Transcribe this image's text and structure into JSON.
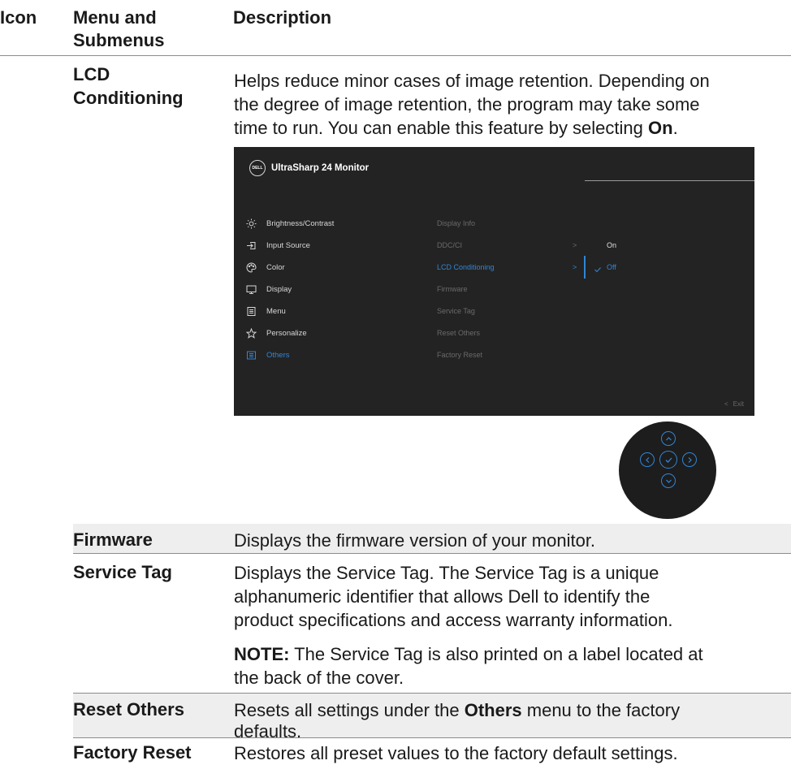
{
  "headers": {
    "icon": "Icon",
    "menu_line1": "Menu and",
    "menu_line2": "Submenus",
    "description": "Description"
  },
  "rows": {
    "lcd": {
      "menu_line1": "LCD",
      "menu_line2": "Conditioning",
      "desc_line1": "Helps reduce minor cases of image retention. Depending on",
      "desc_line2": "the degree of image retention, the program may take some",
      "desc_line3_pre": "time to run. You can enable this feature by selecting ",
      "desc_line3_bold": "On",
      "desc_line3_post": "."
    },
    "firmware": {
      "menu": "Firmware",
      "desc": "Displays the firmware version of your monitor."
    },
    "service_tag": {
      "menu": "Service Tag",
      "desc_line1": "Displays the Service Tag. The Service Tag is a unique",
      "desc_line2": "alphanumeric identifier that allows Dell to identify the",
      "desc_line3": "product specifications and access warranty information.",
      "note_bold": "NOTE:",
      "note_line1": " The Service Tag is also printed on a label located at",
      "note_line2": "the back of the cover."
    },
    "reset_others": {
      "menu": "Reset Others",
      "desc_pre": "Resets all settings under the ",
      "desc_bold": "Others",
      "desc_post": " menu to the factory",
      "desc_line2": "defaults."
    },
    "factory_reset": {
      "menu": "Factory Reset",
      "desc": "Restores all preset values to the factory default settings."
    }
  },
  "osd": {
    "logo_text": "DELL",
    "title": "UltraSharp 24 Monitor",
    "menu_items": [
      {
        "label": "Brightness/Contrast",
        "icon": "brightness-icon"
      },
      {
        "label": "Input Source",
        "icon": "input-source-icon"
      },
      {
        "label": "Color",
        "icon": "color-palette-icon"
      },
      {
        "label": "Display",
        "icon": "display-icon"
      },
      {
        "label": "Menu",
        "icon": "menu-icon"
      },
      {
        "label": "Personalize",
        "icon": "star-icon"
      },
      {
        "label": "Others",
        "icon": "others-icon",
        "active": true
      }
    ],
    "submenu_items": [
      {
        "label": "Display Info"
      },
      {
        "label": "DDC/CI",
        "chevron": ">"
      },
      {
        "label": "LCD Conditioning",
        "chevron": ">",
        "active": true
      },
      {
        "label": "Firmware"
      },
      {
        "label": "Service Tag"
      },
      {
        "label": "Reset Others"
      },
      {
        "label": "Factory Reset"
      }
    ],
    "options": [
      {
        "label": "On"
      },
      {
        "label": "Off",
        "selected": true
      }
    ],
    "exit_label": "Exit",
    "accent_color": "#2f86d8"
  }
}
